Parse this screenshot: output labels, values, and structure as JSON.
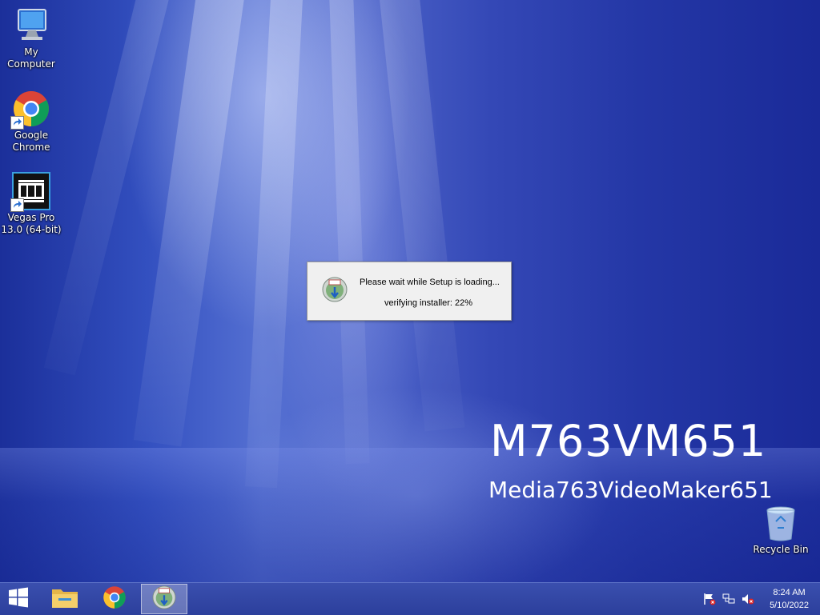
{
  "desktop": {
    "icons": [
      {
        "label": "My Computer",
        "icon": "computer-icon"
      },
      {
        "label": "Google Chrome",
        "icon": "chrome-icon"
      },
      {
        "label": "Vegas Pro 13.0 (64-bit)",
        "icon": "vegas-film-icon"
      },
      {
        "label": "Recycle Bin",
        "icon": "recycle-bin-icon"
      }
    ],
    "watermark_title": "M763VM651",
    "watermark_subtitle": "Media763VideoMaker651"
  },
  "dialog": {
    "icon": "setup-installer-icon",
    "message": "Please wait while Setup is loading...",
    "status": "verifying installer: 22%",
    "progress_percent": 22
  },
  "taskbar": {
    "start_icon": "windows-logo-icon",
    "pinned": [
      {
        "name": "file-explorer",
        "icon": "folder-icon"
      },
      {
        "name": "chrome",
        "icon": "chrome-icon"
      },
      {
        "name": "setup",
        "icon": "setup-installer-icon",
        "active": true
      }
    ],
    "tray_icons": [
      "action-center-flag-icon",
      "network-icon",
      "volume-muted-icon"
    ],
    "time": "8:24 AM",
    "date": "5/10/2022"
  },
  "colors": {
    "desktop_blue": "#2437a6",
    "taskbar": "#2c3f9c",
    "dialog_bg": "#f0f0f0"
  }
}
